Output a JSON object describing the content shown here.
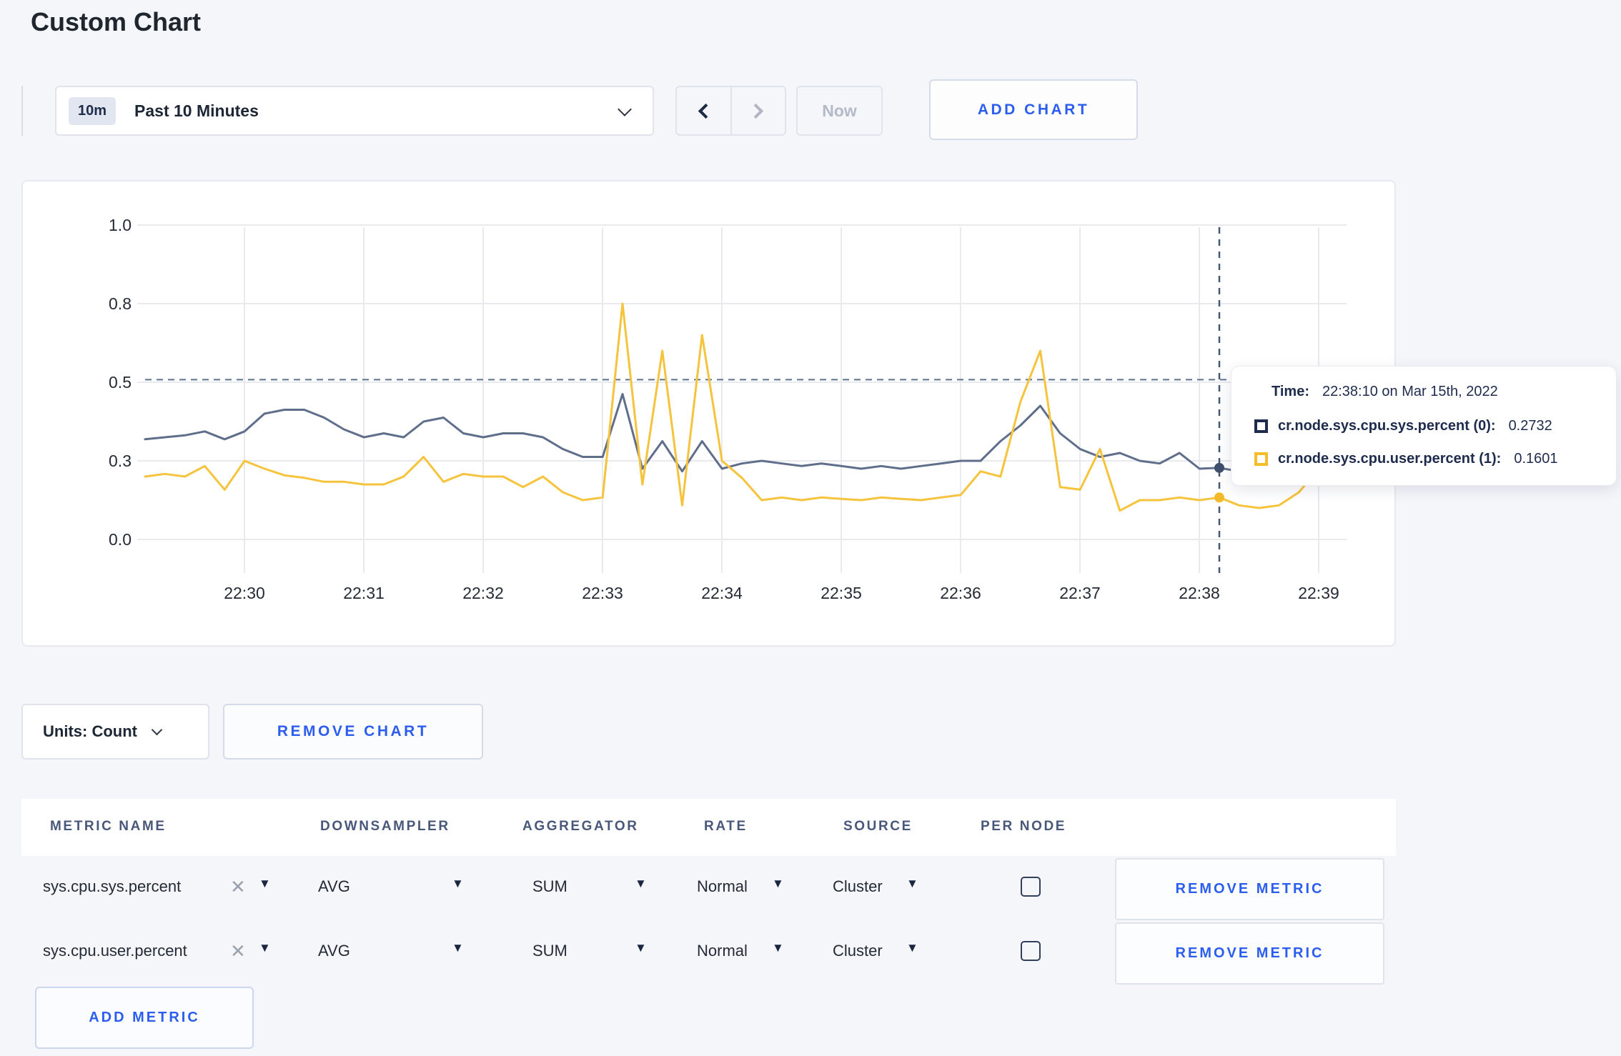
{
  "page": {
    "title": "Custom Chart",
    "accent_blue": "#2b5dee"
  },
  "toolbar": {
    "time_selector": {
      "badge": "10m",
      "label": "Past 10 Minutes"
    },
    "now_button": "Now",
    "add_chart_button": "ADD CHART"
  },
  "chart_controls": {
    "units_label": "Units: Count",
    "remove_chart_button": "REMOVE CHART"
  },
  "tooltip": {
    "time_label": "Time:",
    "time_value": "22:38:10 on Mar 15th, 2022",
    "entries": [
      {
        "label": "cr.node.sys.cpu.sys.percent (0):",
        "value": "0.2732",
        "color": "#1e2b4d"
      },
      {
        "label": "cr.node.sys.cpu.user.percent (1):",
        "value": "0.1601",
        "color": "#f5bd27"
      }
    ]
  },
  "chart_data": {
    "type": "line",
    "title": "Custom Chart",
    "xlabel": "",
    "ylabel": "",
    "grid": true,
    "x_start": "22:29:10",
    "x_step_seconds": 10,
    "x_ticks": [
      "22:30",
      "22:31",
      "22:32",
      "22:33",
      "22:34",
      "22:35",
      "22:36",
      "22:37",
      "22:38",
      "22:39"
    ],
    "y_ticks": [
      0.0,
      0.3,
      0.5,
      0.8,
      1.0
    ],
    "ylim": [
      0,
      1
    ],
    "series": [
      {
        "name": "cr.node.sys.cpu.sys.percent (0)",
        "color": "#5f6e8a",
        "values": [
          0.355,
          0.36,
          0.365,
          0.375,
          0.355,
          0.375,
          0.42,
          0.43,
          0.43,
          0.41,
          0.38,
          0.36,
          0.37,
          0.36,
          0.4,
          0.41,
          0.37,
          0.36,
          0.37,
          0.37,
          0.36,
          0.33,
          0.31,
          0.31,
          0.47,
          0.27,
          0.35,
          0.26,
          0.35,
          0.27,
          0.29,
          0.3,
          0.29,
          0.28,
          0.29,
          0.28,
          0.27,
          0.28,
          0.27,
          0.28,
          0.29,
          0.3,
          0.3,
          0.35,
          0.39,
          0.44,
          0.37,
          0.33,
          0.31,
          0.32,
          0.3,
          0.29,
          0.32,
          0.27,
          0.2732,
          0.26,
          0.28,
          0.33,
          0.31,
          0.3,
          0.31
        ]
      },
      {
        "name": "cr.node.sys.cpu.user.percent (1)",
        "color": "#f6c33d",
        "values": [
          0.24,
          0.25,
          0.24,
          0.28,
          0.19,
          0.3,
          0.27,
          0.245,
          0.235,
          0.22,
          0.22,
          0.21,
          0.21,
          0.24,
          0.31,
          0.22,
          0.25,
          0.24,
          0.24,
          0.2,
          0.24,
          0.18,
          0.15,
          0.16,
          0.8,
          0.21,
          0.62,
          0.13,
          0.68,
          0.3,
          0.235,
          0.15,
          0.16,
          0.15,
          0.16,
          0.155,
          0.15,
          0.16,
          0.155,
          0.15,
          0.16,
          0.17,
          0.26,
          0.24,
          0.45,
          0.62,
          0.2,
          0.19,
          0.33,
          0.11,
          0.15,
          0.15,
          0.16,
          0.15,
          0.1601,
          0.13,
          0.12,
          0.13,
          0.18,
          0.27,
          0.22
        ]
      }
    ],
    "hover": {
      "time": "22:38:10 on Mar 15th, 2022",
      "point_index": 54,
      "guide_value": 0.51,
      "values": [
        0.2732,
        0.1601
      ],
      "dot_colors": [
        "#3e4e6d",
        "#f2ba2a"
      ]
    },
    "legend_position": "tooltip-overlay"
  },
  "metrics_table": {
    "headers": [
      "METRIC NAME",
      "DOWNSAMPLER",
      "AGGREGATOR",
      "RATE",
      "SOURCE",
      "PER NODE"
    ],
    "rows": [
      {
        "name": "sys.cpu.sys.percent",
        "remove_icon": "✕",
        "downsampler": "AVG",
        "aggregator": "SUM",
        "rate": "Normal",
        "source": "Cluster",
        "per_node": false
      },
      {
        "name": "sys.cpu.user.percent",
        "remove_icon": "✕",
        "downsampler": "AVG",
        "aggregator": "SUM",
        "rate": "Normal",
        "source": "Cluster",
        "per_node": false
      }
    ],
    "caret_glyph": "▼",
    "remove_metric_button": "REMOVE METRIC",
    "add_metric_button": "ADD METRIC"
  }
}
